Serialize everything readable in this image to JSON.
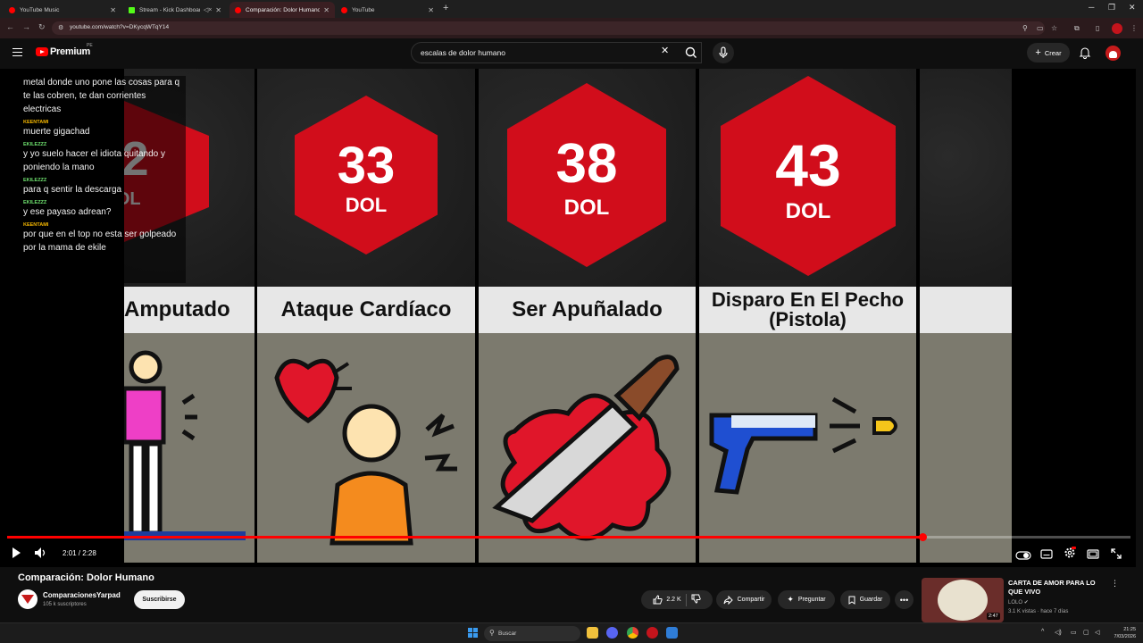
{
  "browser": {
    "tabs": [
      {
        "title": "YouTube Music",
        "icon_color": "#ff0000",
        "active": false
      },
      {
        "title": "Stream - Kick Dashboard",
        "icon_color": "#53fc18",
        "active": false
      },
      {
        "title": "Comparación: Dolor Humano",
        "icon_color": "#ff0000",
        "active": true
      },
      {
        "title": "YouTube",
        "icon_color": "#ff0000",
        "active": false
      }
    ],
    "url": "youtube.com/watch?v=DKycqWTqY14"
  },
  "youtube": {
    "logo_text": "Premium",
    "logo_sup": "PE",
    "search_query": "escalas de dolor humano",
    "create_label": "Crear"
  },
  "video": {
    "cards": [
      {
        "value": "32",
        "unit": "DOL",
        "label": "Amputado"
      },
      {
        "value": "33",
        "unit": "DOL",
        "label": "Ataque Cardíaco"
      },
      {
        "value": "38",
        "unit": "DOL",
        "label": "Ser Apuñalado"
      },
      {
        "value": "43",
        "unit": "DOL",
        "label": "Disparo En El Pecho (Pistola)"
      }
    ],
    "chat": [
      {
        "user": "",
        "message": "metal donde uno pone las cosas para q te las cobren, te dan corrientes electricas",
        "color": "#ffffff"
      },
      {
        "user": "KEENTAMI",
        "message": "muerte gigachad",
        "color": "#f5b700"
      },
      {
        "user": "EKILEZZZ",
        "message": "y yo suelo hacer el idiota quitando y poniendo la mano",
        "color": "#6ee06e"
      },
      {
        "user": "EKILEZZZ",
        "message": "para q sentir la descarga",
        "color": "#6ee06e"
      },
      {
        "user": "EKILEZZZ",
        "message": "y ese payaso adrean?",
        "color": "#6ee06e"
      },
      {
        "user": "KEENTAMI",
        "message": "por que en el top no esta ser golpeado por la mama de ekile",
        "color": "#f5b700"
      }
    ],
    "progress": 0.815,
    "time_text": "2:01 / 2:28"
  },
  "details": {
    "title": "Comparación: Dolor Humano",
    "channel": "ComparacionesYarpad",
    "subscribers": "105 k suscriptores",
    "subscribe_label": "Suscribirse",
    "likes": "2.2 K",
    "share_label": "Compartir",
    "ask_label": "Preguntar",
    "save_label": "Guardar"
  },
  "recommendation": {
    "title": "CARTA DE AMOR PARA LO QUE VIVO",
    "channel": "LOLO",
    "meta": "3.1 K vistas · hace 7 días",
    "duration": "2:47"
  },
  "taskbar": {
    "search_placeholder": "Buscar",
    "time": "21:25",
    "date": "7/03/2026"
  },
  "colors": {
    "accent": "#ff0000",
    "hexagon": "#d10d1b",
    "label_band": "#e7e7e7",
    "card_bottom": "#7c7a6e"
  }
}
